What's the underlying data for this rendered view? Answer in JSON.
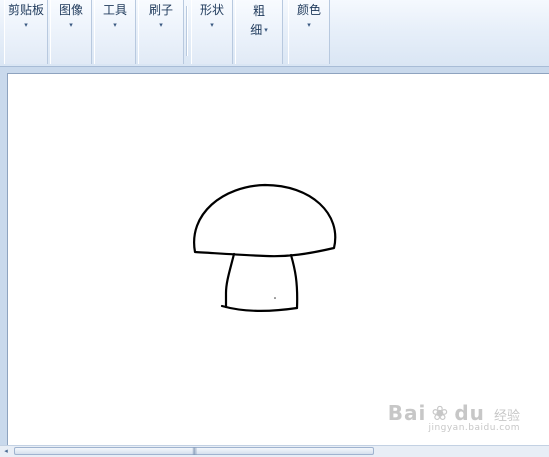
{
  "ribbon": {
    "groups": [
      {
        "label": "剪贴板"
      },
      {
        "label": "图像"
      },
      {
        "label": "工具"
      },
      {
        "label": "刷子"
      },
      {
        "label": "形状"
      },
      {
        "label_line1": "粗",
        "label_line2": "细"
      },
      {
        "label": "颜色"
      }
    ],
    "dropdown_glyph": "▾"
  },
  "canvas": {
    "drawing": "mushroom-sketch"
  },
  "watermark": {
    "brand": "Bai",
    "brand_suffix": "du",
    "jingyan": "经验",
    "url": "jingyan.baidu.com"
  },
  "scrollbar": {
    "grip": "|||"
  }
}
